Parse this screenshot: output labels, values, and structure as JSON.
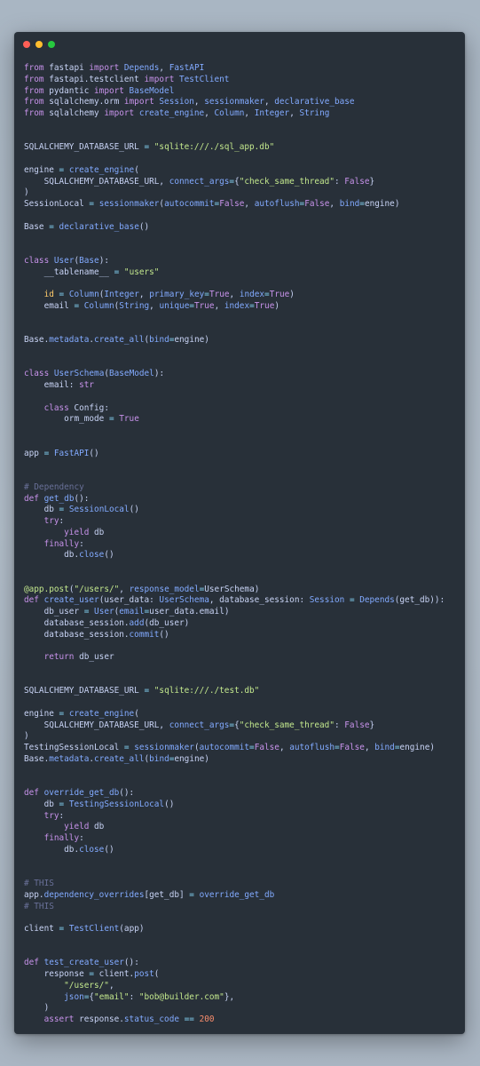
{
  "code_lines": [
    [
      [
        "kw",
        "from"
      ],
      [
        "pl",
        " fastapi "
      ],
      [
        "kw",
        "import"
      ],
      [
        "fn",
        " Depends"
      ],
      [
        "pl",
        ", "
      ],
      [
        "fn",
        "FastAPI"
      ]
    ],
    [
      [
        "kw",
        "from"
      ],
      [
        "pl",
        " fastapi.testclient "
      ],
      [
        "kw",
        "import"
      ],
      [
        "fn",
        " TestClient"
      ]
    ],
    [
      [
        "kw",
        "from"
      ],
      [
        "pl",
        " pydantic "
      ],
      [
        "kw",
        "import"
      ],
      [
        "fn",
        " BaseModel"
      ]
    ],
    [
      [
        "kw",
        "from"
      ],
      [
        "pl",
        " sqlalchemy.orm "
      ],
      [
        "kw",
        "import"
      ],
      [
        "fn",
        " Session"
      ],
      [
        "pl",
        ", "
      ],
      [
        "fn",
        "sessionmaker"
      ],
      [
        "pl",
        ", "
      ],
      [
        "fn",
        "declarative_base"
      ]
    ],
    [
      [
        "kw",
        "from"
      ],
      [
        "pl",
        " sqlalchemy "
      ],
      [
        "kw",
        "import"
      ],
      [
        "fn",
        " create_engine"
      ],
      [
        "pl",
        ", "
      ],
      [
        "fn",
        "Column"
      ],
      [
        "pl",
        ", "
      ],
      [
        "fn",
        "Integer"
      ],
      [
        "pl",
        ", "
      ],
      [
        "fn",
        "String"
      ]
    ],
    [],
    [],
    [
      [
        "pl",
        "SQLALCHEMY_DATABASE_URL "
      ],
      [
        "op",
        "="
      ],
      [
        "pl",
        " "
      ],
      [
        "str",
        "\"sqlite:///./sql_app.db\""
      ]
    ],
    [],
    [
      [
        "pl",
        "engine "
      ],
      [
        "op",
        "="
      ],
      [
        "pl",
        " "
      ],
      [
        "fn",
        "create_engine"
      ],
      [
        "pl",
        "("
      ]
    ],
    [
      [
        "pl",
        "    SQLALCHEMY_DATABASE_URL, "
      ],
      [
        "fn",
        "connect_args"
      ],
      [
        "op",
        "="
      ],
      [
        "pl",
        "{"
      ],
      [
        "str",
        "\"check_same_thread\""
      ],
      [
        "pl",
        ": "
      ],
      [
        "kw",
        "False"
      ],
      [
        "pl",
        "}"
      ]
    ],
    [
      [
        "pl",
        ")"
      ]
    ],
    [
      [
        "pl",
        "SessionLocal "
      ],
      [
        "op",
        "="
      ],
      [
        "pl",
        " "
      ],
      [
        "fn",
        "sessionmaker"
      ],
      [
        "pl",
        "("
      ],
      [
        "fn",
        "autocommit"
      ],
      [
        "op",
        "="
      ],
      [
        "kw",
        "False"
      ],
      [
        "pl",
        ", "
      ],
      [
        "fn",
        "autoflush"
      ],
      [
        "op",
        "="
      ],
      [
        "kw",
        "False"
      ],
      [
        "pl",
        ", "
      ],
      [
        "fn",
        "bind"
      ],
      [
        "op",
        "="
      ],
      [
        "pl",
        "engine)"
      ]
    ],
    [],
    [
      [
        "pl",
        "Base "
      ],
      [
        "op",
        "="
      ],
      [
        "pl",
        " "
      ],
      [
        "fn",
        "declarative_base"
      ],
      [
        "pl",
        "()"
      ]
    ],
    [],
    [],
    [
      [
        "kw",
        "class"
      ],
      [
        "pl",
        " "
      ],
      [
        "fn",
        "User"
      ],
      [
        "pl",
        "("
      ],
      [
        "fn",
        "Base"
      ],
      [
        "pl",
        "):"
      ]
    ],
    [
      [
        "pl",
        "    __tablename__ "
      ],
      [
        "op",
        "="
      ],
      [
        "pl",
        " "
      ],
      [
        "str",
        "\"users\""
      ]
    ],
    [],
    [
      [
        "pl",
        "    "
      ],
      [
        "cls",
        "id"
      ],
      [
        "pl",
        " "
      ],
      [
        "op",
        "="
      ],
      [
        "pl",
        " "
      ],
      [
        "fn",
        "Column"
      ],
      [
        "pl",
        "("
      ],
      [
        "fn",
        "Integer"
      ],
      [
        "pl",
        ", "
      ],
      [
        "fn",
        "primary_key"
      ],
      [
        "op",
        "="
      ],
      [
        "kw",
        "True"
      ],
      [
        "pl",
        ", "
      ],
      [
        "fn",
        "index"
      ],
      [
        "op",
        "="
      ],
      [
        "kw",
        "True"
      ],
      [
        "pl",
        ")"
      ]
    ],
    [
      [
        "pl",
        "    email "
      ],
      [
        "op",
        "="
      ],
      [
        "pl",
        " "
      ],
      [
        "fn",
        "Column"
      ],
      [
        "pl",
        "("
      ],
      [
        "fn",
        "String"
      ],
      [
        "pl",
        ", "
      ],
      [
        "fn",
        "unique"
      ],
      [
        "op",
        "="
      ],
      [
        "kw",
        "True"
      ],
      [
        "pl",
        ", "
      ],
      [
        "fn",
        "index"
      ],
      [
        "op",
        "="
      ],
      [
        "kw",
        "True"
      ],
      [
        "pl",
        ")"
      ]
    ],
    [],
    [],
    [
      [
        "pl",
        "Base."
      ],
      [
        "fn",
        "metadata"
      ],
      [
        "pl",
        "."
      ],
      [
        "fn",
        "create_all"
      ],
      [
        "pl",
        "("
      ],
      [
        "fn",
        "bind"
      ],
      [
        "op",
        "="
      ],
      [
        "pl",
        "engine)"
      ]
    ],
    [],
    [],
    [
      [
        "kw",
        "class"
      ],
      [
        "pl",
        " "
      ],
      [
        "fn",
        "UserSchema"
      ],
      [
        "pl",
        "("
      ],
      [
        "fn",
        "BaseModel"
      ],
      [
        "pl",
        "):"
      ]
    ],
    [
      [
        "pl",
        "    email: "
      ],
      [
        "kw",
        "str"
      ]
    ],
    [],
    [
      [
        "pl",
        "    "
      ],
      [
        "kw",
        "class"
      ],
      [
        "pl",
        " Config:"
      ]
    ],
    [
      [
        "pl",
        "        orm_mode "
      ],
      [
        "op",
        "="
      ],
      [
        "pl",
        " "
      ],
      [
        "kw",
        "True"
      ]
    ],
    [],
    [],
    [
      [
        "pl",
        "app "
      ],
      [
        "op",
        "="
      ],
      [
        "pl",
        " "
      ],
      [
        "fn",
        "FastAPI"
      ],
      [
        "pl",
        "()"
      ]
    ],
    [],
    [],
    [
      [
        "cm",
        "# Dependency"
      ]
    ],
    [
      [
        "kw",
        "def"
      ],
      [
        "pl",
        " "
      ],
      [
        "fn",
        "get_db"
      ],
      [
        "pl",
        "():"
      ]
    ],
    [
      [
        "pl",
        "    db "
      ],
      [
        "op",
        "="
      ],
      [
        "pl",
        " "
      ],
      [
        "fn",
        "SessionLocal"
      ],
      [
        "pl",
        "()"
      ]
    ],
    [
      [
        "pl",
        "    "
      ],
      [
        "kw",
        "try"
      ],
      [
        "pl",
        ":"
      ]
    ],
    [
      [
        "pl",
        "        "
      ],
      [
        "kw",
        "yield"
      ],
      [
        "pl",
        " db"
      ]
    ],
    [
      [
        "pl",
        "    "
      ],
      [
        "kw",
        "finally"
      ],
      [
        "pl",
        ":"
      ]
    ],
    [
      [
        "pl",
        "        db."
      ],
      [
        "fn",
        "close"
      ],
      [
        "pl",
        "()"
      ]
    ],
    [],
    [],
    [
      [
        "dec",
        "@app.post"
      ],
      [
        "pl",
        "("
      ],
      [
        "str",
        "\"/users/\""
      ],
      [
        "pl",
        ", "
      ],
      [
        "fn",
        "response_model"
      ],
      [
        "op",
        "="
      ],
      [
        "pl",
        "UserSchema)"
      ]
    ],
    [
      [
        "kw",
        "def"
      ],
      [
        "pl",
        " "
      ],
      [
        "fn",
        "create_user"
      ],
      [
        "pl",
        "(user_data: "
      ],
      [
        "fn",
        "UserSchema"
      ],
      [
        "pl",
        ", database_session: "
      ],
      [
        "fn",
        "Session"
      ],
      [
        "pl",
        " "
      ],
      [
        "op",
        "="
      ],
      [
        "pl",
        " "
      ],
      [
        "fn",
        "Depends"
      ],
      [
        "pl",
        "(get_db)):"
      ]
    ],
    [
      [
        "pl",
        "    db_user "
      ],
      [
        "op",
        "="
      ],
      [
        "pl",
        " "
      ],
      [
        "fn",
        "User"
      ],
      [
        "pl",
        "("
      ],
      [
        "fn",
        "email"
      ],
      [
        "op",
        "="
      ],
      [
        "pl",
        "user_data.email)"
      ]
    ],
    [
      [
        "pl",
        "    database_session."
      ],
      [
        "fn",
        "add"
      ],
      [
        "pl",
        "(db_user)"
      ]
    ],
    [
      [
        "pl",
        "    database_session."
      ],
      [
        "fn",
        "commit"
      ],
      [
        "pl",
        "()"
      ]
    ],
    [],
    [
      [
        "pl",
        "    "
      ],
      [
        "kw",
        "return"
      ],
      [
        "pl",
        " db_user"
      ]
    ],
    [],
    [],
    [
      [
        "pl",
        "SQLALCHEMY_DATABASE_URL "
      ],
      [
        "op",
        "="
      ],
      [
        "pl",
        " "
      ],
      [
        "str",
        "\"sqlite:///./test.db\""
      ]
    ],
    [],
    [
      [
        "pl",
        "engine "
      ],
      [
        "op",
        "="
      ],
      [
        "pl",
        " "
      ],
      [
        "fn",
        "create_engine"
      ],
      [
        "pl",
        "("
      ]
    ],
    [
      [
        "pl",
        "    SQLALCHEMY_DATABASE_URL, "
      ],
      [
        "fn",
        "connect_args"
      ],
      [
        "op",
        "="
      ],
      [
        "pl",
        "{"
      ],
      [
        "str",
        "\"check_same_thread\""
      ],
      [
        "pl",
        ": "
      ],
      [
        "kw",
        "False"
      ],
      [
        "pl",
        "}"
      ]
    ],
    [
      [
        "pl",
        ")"
      ]
    ],
    [
      [
        "pl",
        "TestingSessionLocal "
      ],
      [
        "op",
        "="
      ],
      [
        "pl",
        " "
      ],
      [
        "fn",
        "sessionmaker"
      ],
      [
        "pl",
        "("
      ],
      [
        "fn",
        "autocommit"
      ],
      [
        "op",
        "="
      ],
      [
        "kw",
        "False"
      ],
      [
        "pl",
        ", "
      ],
      [
        "fn",
        "autoflush"
      ],
      [
        "op",
        "="
      ],
      [
        "kw",
        "False"
      ],
      [
        "pl",
        ", "
      ],
      [
        "fn",
        "bind"
      ],
      [
        "op",
        "="
      ],
      [
        "pl",
        "engine)"
      ]
    ],
    [
      [
        "pl",
        "Base."
      ],
      [
        "fn",
        "metadata"
      ],
      [
        "pl",
        "."
      ],
      [
        "fn",
        "create_all"
      ],
      [
        "pl",
        "("
      ],
      [
        "fn",
        "bind"
      ],
      [
        "op",
        "="
      ],
      [
        "pl",
        "engine)"
      ]
    ],
    [],
    [],
    [
      [
        "kw",
        "def"
      ],
      [
        "pl",
        " "
      ],
      [
        "fn",
        "override_get_db"
      ],
      [
        "pl",
        "():"
      ]
    ],
    [
      [
        "pl",
        "    db "
      ],
      [
        "op",
        "="
      ],
      [
        "pl",
        " "
      ],
      [
        "fn",
        "TestingSessionLocal"
      ],
      [
        "pl",
        "()"
      ]
    ],
    [
      [
        "pl",
        "    "
      ],
      [
        "kw",
        "try"
      ],
      [
        "pl",
        ":"
      ]
    ],
    [
      [
        "pl",
        "        "
      ],
      [
        "kw",
        "yield"
      ],
      [
        "pl",
        " db"
      ]
    ],
    [
      [
        "pl",
        "    "
      ],
      [
        "kw",
        "finally"
      ],
      [
        "pl",
        ":"
      ]
    ],
    [
      [
        "pl",
        "        db."
      ],
      [
        "fn",
        "close"
      ],
      [
        "pl",
        "()"
      ]
    ],
    [],
    [],
    [
      [
        "cm",
        "# THIS"
      ]
    ],
    [
      [
        "pl",
        "app."
      ],
      [
        "fn",
        "dependency_overrides"
      ],
      [
        "pl",
        "[get_db] "
      ],
      [
        "op",
        "="
      ],
      [
        "pl",
        " "
      ],
      [
        "fn",
        "override_get_db"
      ]
    ],
    [
      [
        "cm",
        "# THIS"
      ]
    ],
    [],
    [
      [
        "pl",
        "client "
      ],
      [
        "op",
        "="
      ],
      [
        "pl",
        " "
      ],
      [
        "fn",
        "TestClient"
      ],
      [
        "pl",
        "(app)"
      ]
    ],
    [],
    [],
    [
      [
        "kw",
        "def"
      ],
      [
        "pl",
        " "
      ],
      [
        "fn",
        "test_create_user"
      ],
      [
        "pl",
        "():"
      ]
    ],
    [
      [
        "pl",
        "    response "
      ],
      [
        "op",
        "="
      ],
      [
        "pl",
        " client."
      ],
      [
        "fn",
        "post"
      ],
      [
        "pl",
        "("
      ]
    ],
    [
      [
        "pl",
        "        "
      ],
      [
        "str",
        "\"/users/\""
      ],
      [
        "pl",
        ","
      ]
    ],
    [
      [
        "pl",
        "        "
      ],
      [
        "fn",
        "json"
      ],
      [
        "op",
        "="
      ],
      [
        "pl",
        "{"
      ],
      [
        "str",
        "\"email\""
      ],
      [
        "pl",
        ": "
      ],
      [
        "str",
        "\"bob@builder.com\""
      ],
      [
        "pl",
        "},"
      ]
    ],
    [
      [
        "pl",
        "    )"
      ]
    ],
    [
      [
        "pl",
        "    "
      ],
      [
        "kw",
        "assert"
      ],
      [
        "pl",
        " response."
      ],
      [
        "fn",
        "status_code"
      ],
      [
        "pl",
        " "
      ],
      [
        "op",
        "=="
      ],
      [
        "pl",
        " "
      ],
      [
        "num",
        "200"
      ]
    ]
  ]
}
